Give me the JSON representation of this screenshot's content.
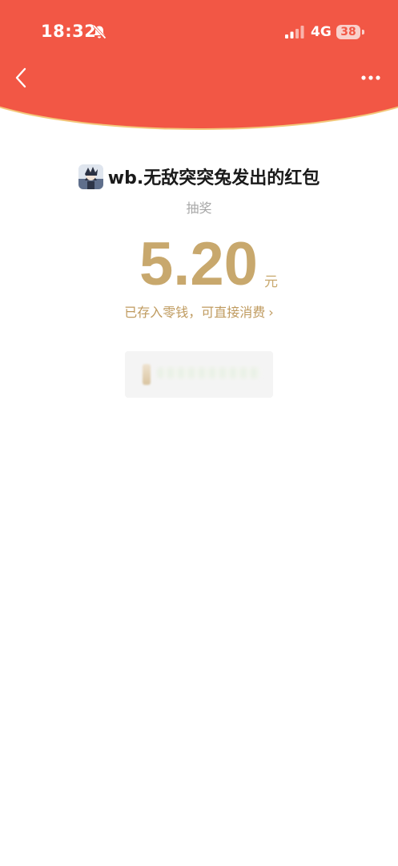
{
  "status_bar": {
    "time": "18:32",
    "network": "4G",
    "battery": "38"
  },
  "colors": {
    "header_red": "#f25745",
    "gold": "#c8a86d"
  },
  "header": {
    "back_icon": "chevron-left-icon",
    "more_icon": "more-dots-icon"
  },
  "red_packet": {
    "sender_title": "wb.无敌突突兔发出的红包",
    "subtitle": "抽奖",
    "amount": "5.20",
    "unit": "元",
    "saved_text": "已存入零钱，可直接消费",
    "saved_chevron": "›"
  }
}
